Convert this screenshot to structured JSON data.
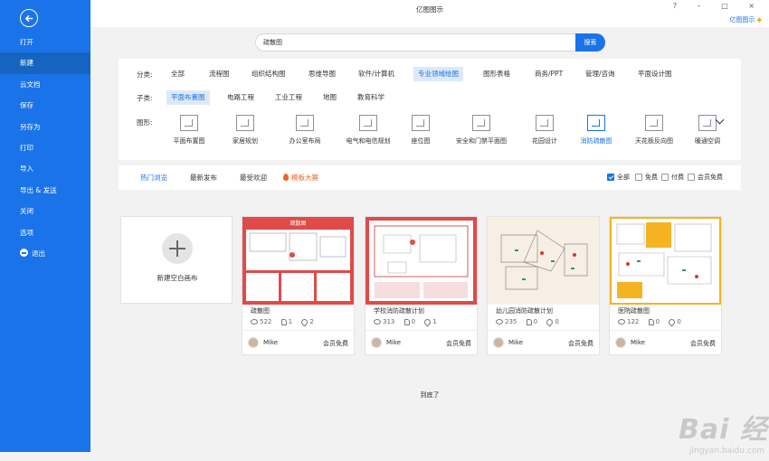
{
  "window": {
    "title": "亿图图示",
    "brand": "亿图图示",
    "controls": "? – □ ×"
  },
  "sidebar": {
    "items": [
      {
        "label": "打开"
      },
      {
        "label": "新建"
      },
      {
        "label": "云文档"
      },
      {
        "label": "保存"
      },
      {
        "label": "另存为"
      },
      {
        "label": "打印"
      },
      {
        "label": "导入"
      },
      {
        "label": "导出 & 发送"
      },
      {
        "label": "关闭"
      },
      {
        "label": "选项"
      },
      {
        "label": "退出"
      }
    ]
  },
  "search": {
    "value": "疏散图",
    "button": "搜索"
  },
  "filter": {
    "category_label": "分类:",
    "categories": [
      "全部",
      "流程图",
      "组织结构图",
      "思维导图",
      "软件/计算机",
      "专业领域绘图",
      "图形表格",
      "商务/PPT",
      "管理/咨询",
      "平面设计图"
    ],
    "active_category": "专业领域绘图",
    "subcategory_label": "子类:",
    "subcategories": [
      "平面布置图",
      "电路工程",
      "工业工程",
      "地图",
      "教育科学"
    ],
    "active_subcategory": "平面布置图",
    "shapes_label": "图形:",
    "shapes": [
      "平面布置图",
      "家居规划",
      "办公室布局",
      "电气和电信规划",
      "座位图",
      "安全和门禁平面图",
      "花园设计",
      "消防疏散图",
      "天花板反向图",
      "暖通空调"
    ],
    "active_shape": "消防疏散图"
  },
  "sort": {
    "tabs": [
      "热门浏览",
      "最新发布",
      "最受欢迎",
      "模板大赛"
    ],
    "active": "热门浏览",
    "checkboxes": [
      {
        "label": "全部",
        "checked": true
      },
      {
        "label": "免费",
        "checked": false
      },
      {
        "label": "付费",
        "checked": false
      },
      {
        "label": "会员免费",
        "checked": false
      }
    ]
  },
  "new_blank": {
    "label": "新建空白画布"
  },
  "templates": [
    {
      "title": "疏散图",
      "views": "522",
      "likes": "1",
      "favs": "2",
      "author": "Mike",
      "tag": "会员免费",
      "accent": "#e04a4a",
      "thumb_caption": "疏散图"
    },
    {
      "title": "学校消防疏散计划",
      "views": "313",
      "likes": "0",
      "favs": "1",
      "author": "Mike",
      "tag": "会员免费",
      "accent": "#e04a4a"
    },
    {
      "title": "幼儿园消防疏散计划",
      "views": "235",
      "likes": "0",
      "favs": "0",
      "author": "Mike",
      "tag": "会员免费",
      "accent": "#f7efe3"
    },
    {
      "title": "医院疏散图",
      "views": "122",
      "likes": "0",
      "favs": "0",
      "author": "Mike",
      "tag": "会员免费",
      "accent": "#f5b322"
    }
  ],
  "footer": {
    "end_text": "到底了"
  },
  "watermark": {
    "logo": "Bai 经验",
    "url": "jingyan.baidu.com"
  }
}
